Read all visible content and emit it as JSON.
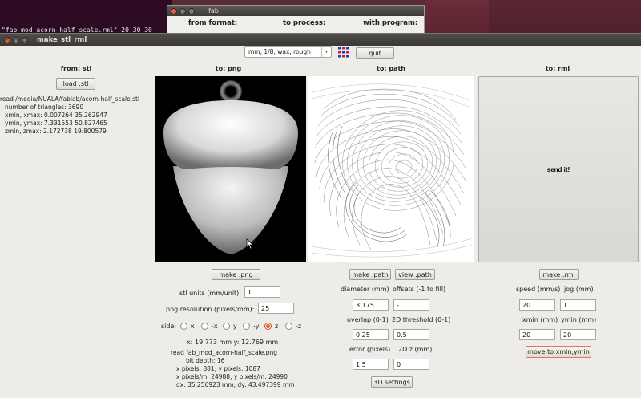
{
  "background": {
    "terminal_text": "\"fab_mod_acorn-half_scale.rml\" 20 30 30",
    "fab_window": {
      "title": "fab",
      "labels": [
        "from format:",
        "to process:",
        "with program:"
      ]
    }
  },
  "window": {
    "title": "make_stl_rml",
    "controls": {
      "close": "×",
      "minimize": "–",
      "maximize": "□"
    }
  },
  "toolbar": {
    "format_value": "mm, 1/8, wax, rough",
    "select_arrow": "▾",
    "quit_label": "quit"
  },
  "stl": {
    "header": "from: stl",
    "load_label": "load .stl",
    "info": [
      "read /media/NUALA/fablab/acorn-half_scale.stl",
      "number of triangles: 3690",
      "xmin, xmax: 0.007264 35.262947",
      "ymin, ymax: 7.331553 50.827465",
      "zmin, zmax: 2.172738 19.800579"
    ]
  },
  "png": {
    "header": "to: png",
    "make_label": "make .png",
    "units_label": "stl units (mm/unit):",
    "units_value": "1",
    "resolution_label": "png resolution (pixels/mm):",
    "resolution_value": "25",
    "side_label": "side:",
    "sides": [
      "x",
      "-x",
      "y",
      "-y",
      "z",
      "-z"
    ],
    "selected_side": "z",
    "coords": "x: 19.773 mm  y: 12.769 mm",
    "info": [
      "read fab_mod_acorn-half_scale.png",
      "bit depth: 16",
      "x pixels: 881, y pixels: 1087",
      "x pixels/m: 24988, y pixels/m: 24990",
      "dx: 35.256923 mm, dy: 43.497399 mm"
    ]
  },
  "path": {
    "header": "to: path",
    "make_label": "make .path",
    "view_label": "view .path",
    "diameter_label": "diameter (mm)",
    "diameter_value": "3.175",
    "offsets_label": "offsets (-1 to fill)",
    "offsets_value": "-1",
    "overlap_label": "overlap (0-1)",
    "overlap_value": "0.25",
    "threshold_label": "2D threshold (0-1)",
    "threshold_value": "0.5",
    "error_label": "error (pixels)",
    "error_value": "1.5",
    "z_label": "2D z (mm)",
    "z_value": "0",
    "settings_label": "3D settings"
  },
  "rml": {
    "header": "to: rml",
    "send_label": "send it!",
    "make_label": "make .rml",
    "speed_label": "speed (mm/s)",
    "speed_value": "20",
    "jog_label": "jog (mm)",
    "jog_value": "1",
    "xmin_label": "xmin (mm)",
    "xmin_value": "20",
    "ymin_label": "ymin (mm)",
    "ymin_value": "20",
    "move_label": "move to xmin,ymin"
  },
  "colors": {
    "accent_border": "#d77b55",
    "radio_selected": "#e0662a"
  }
}
